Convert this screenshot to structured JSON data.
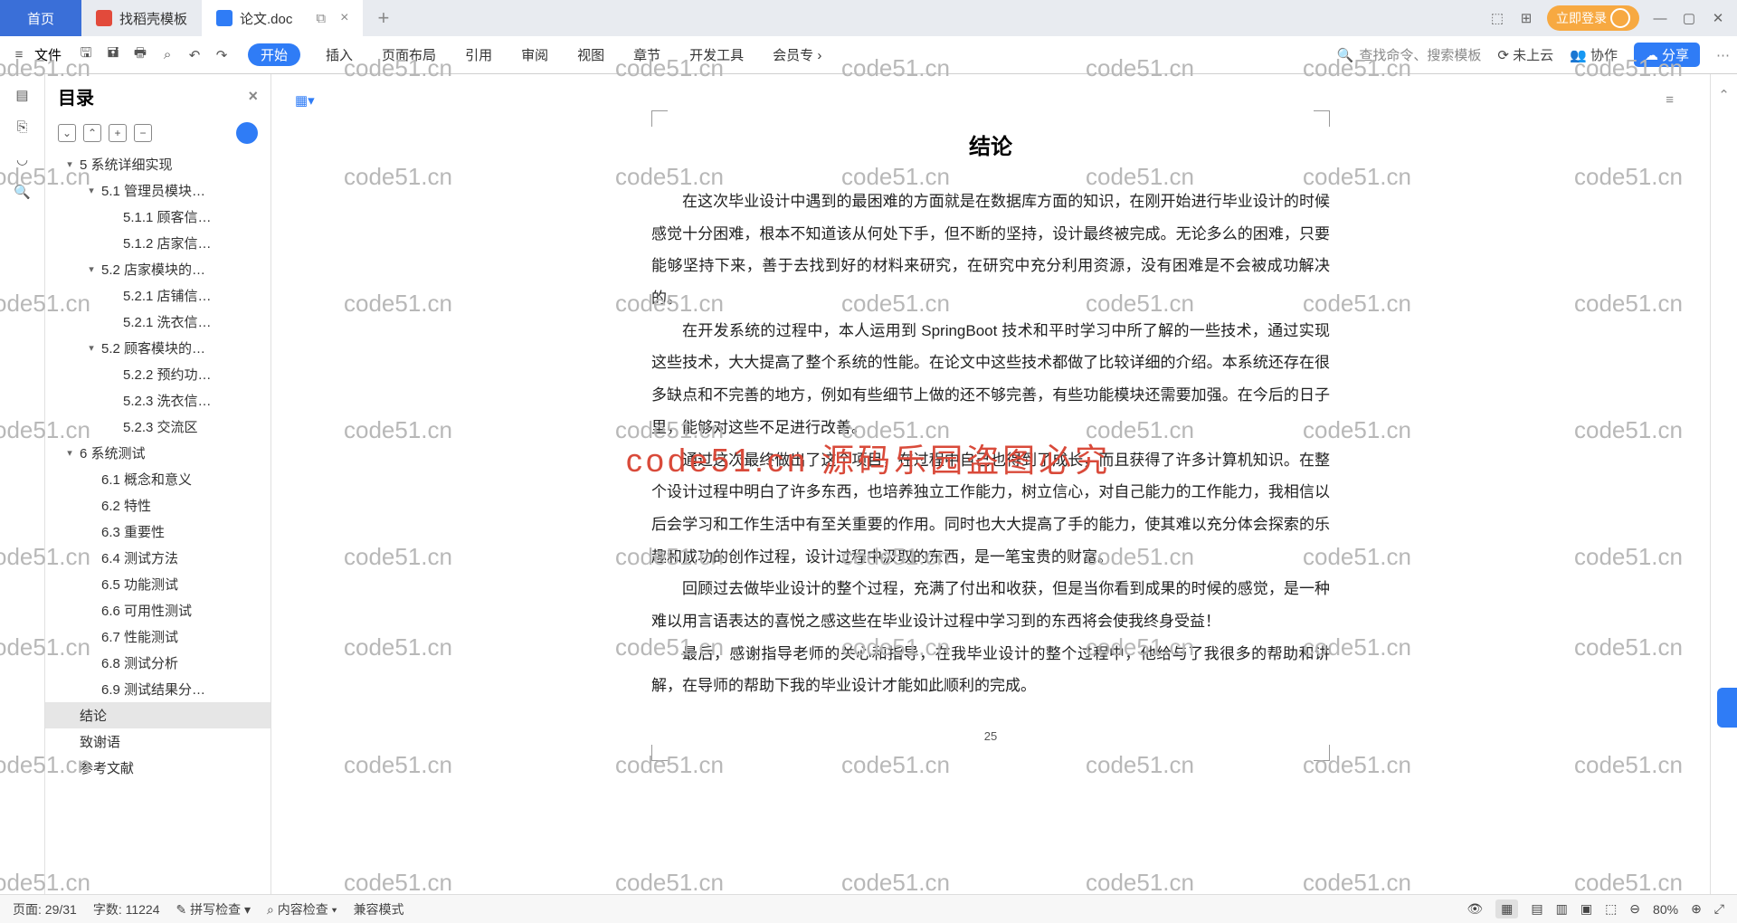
{
  "tabs": {
    "home": "首页",
    "t1": "找稻壳模板",
    "t2": "论文.doc"
  },
  "login": "立即登录",
  "menu": {
    "file": "文件",
    "start": "开始",
    "insert": "插入",
    "layout": "页面布局",
    "ref": "引用",
    "review": "审阅",
    "view": "视图",
    "chapter": "章节",
    "dev": "开发工具",
    "member": "会员专"
  },
  "search": "查找命令、搜索模板",
  "cloud": "未上云",
  "collab": "协作",
  "share": "分享",
  "sidebar": {
    "title": "目录"
  },
  "toc": [
    {
      "t": "5 系统详细实现",
      "lv": 0,
      "c": 1
    },
    {
      "t": "5.1 管理员模块…",
      "lv": 1,
      "c": 1
    },
    {
      "t": "5.1.1 顾客信…",
      "lv": 2
    },
    {
      "t": "5.1.2 店家信…",
      "lv": 2
    },
    {
      "t": "5.2 店家模块的…",
      "lv": 1,
      "c": 1
    },
    {
      "t": "5.2.1 店铺信…",
      "lv": 2
    },
    {
      "t": "5.2.1 洗衣信…",
      "lv": 2
    },
    {
      "t": "5.2 顾客模块的…",
      "lv": 1,
      "c": 1
    },
    {
      "t": "5.2.2 预约功…",
      "lv": 2
    },
    {
      "t": "5.2.3 洗衣信…",
      "lv": 2
    },
    {
      "t": "5.2.3 交流区",
      "lv": 2
    },
    {
      "t": "6 系统测试",
      "lv": 0,
      "c": 1
    },
    {
      "t": "6.1 概念和意义",
      "lv": 1
    },
    {
      "t": "6.2 特性",
      "lv": 1
    },
    {
      "t": "6.3 重要性",
      "lv": 1
    },
    {
      "t": "6.4 测试方法",
      "lv": 1
    },
    {
      "t": "6.5 功能测试",
      "lv": 1
    },
    {
      "t": "6.6 可用性测试",
      "lv": 1
    },
    {
      "t": "6.7 性能测试",
      "lv": 1
    },
    {
      "t": "6.8 测试分析",
      "lv": 1
    },
    {
      "t": "6.9 测试结果分…",
      "lv": 1
    },
    {
      "t": "结论",
      "lv": 0,
      "sel": 1
    },
    {
      "t": "致谢语",
      "lv": 0
    },
    {
      "t": "参考文献",
      "lv": 0
    }
  ],
  "doc": {
    "title": "结论",
    "p1": "在这次毕业设计中遇到的最困难的方面就是在数据库方面的知识，在刚开始进行毕业设计的时候感觉十分困难，根本不知道该从何处下手，但不断的坚持，设计最终被完成。无论多么的困难，只要能够坚持下来，善于去找到好的材料来研究，在研究中充分利用资源，没有困难是不会被成功解决的。",
    "p2": "在开发系统的过程中，本人运用到 SpringBoot 技术和平时学习中所了解的一些技术，通过实现这些技术，大大提高了整个系统的性能。在论文中这些技术都做了比较详细的介绍。本系统还存在很多缺点和不完善的地方，例如有些细节上做的还不够完善，有些功能模块还需要加强。在今后的日子里，能够对这些不足进行改善。",
    "p3": "通过这次最终做出了这个项目，在过程中自己也得到了成长，而且获得了许多计算机知识。在整个设计过程中明白了许多东西，也培养独立工作能力，树立信心，对自己能力的工作能力，我相信以后会学习和工作生活中有至关重要的作用。同时也大大提高了手的能力，使其难以充分体会探索的乐趣和成功的创作过程，设计过程中汲取的东西，是一笔宝贵的财富。",
    "p4": "回顾过去做毕业设计的整个过程，充满了付出和收获，但是当你看到成果的时候的感觉，是一种难以用言语表达的喜悦之感这些在毕业设计过程中学习到的东西将会使我终身受益！",
    "p5": "最后，感谢指导老师的关心和指导，在我毕业设计的整个过程中，他给与了我很多的帮助和讲解，在导师的帮助下我的毕业设计才能如此顺利的完成。",
    "pagenum": "25"
  },
  "wm": "code51.cn",
  "wm_red": "code51.cn 源码乐园盗图必究",
  "status": {
    "page": "页面: 29/31",
    "words": "字数: 11224",
    "spell": "拼写检查",
    "content": "内容检查",
    "compat": "兼容模式",
    "zoom": "80%"
  }
}
